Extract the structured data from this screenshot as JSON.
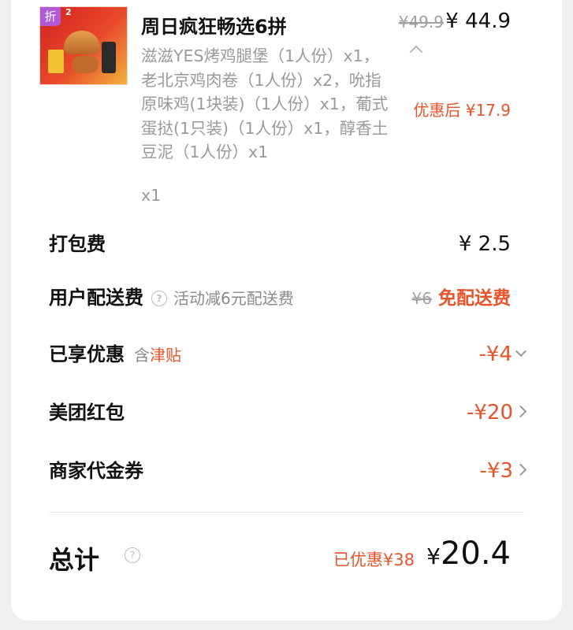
{
  "item": {
    "badge": "折",
    "badge_count": "2",
    "title": "周日疯狂畅选6拼",
    "description": "滋滋YES烤鸡腿堡（1人份）x1，老北京鸡肉卷（1人份）x2，吮指原味鸡(1块装)（1人份）x1，葡式蛋挞(1只装)（1人份）x1，醇香土豆泥（1人份）x1",
    "quantity": "x1",
    "original_price": "¥49.9",
    "price": "¥ 44.9",
    "discounted_price": "优惠后 ¥17.9"
  },
  "rows": {
    "packing": {
      "label": "打包费",
      "value": "¥ 2.5"
    },
    "delivery": {
      "label": "用户配送费",
      "note": "活动减6元配送费",
      "original": "¥6",
      "value": "免配送费"
    },
    "discount": {
      "label": "已享优惠",
      "note_prefix": "含",
      "note_highlight": "津贴",
      "value": "-¥4"
    },
    "redpacket": {
      "label": "美团红包",
      "value": "-¥20"
    },
    "voucher": {
      "label": "商家代金券",
      "value": "-¥3"
    }
  },
  "total": {
    "label": "总计",
    "saved": "已优惠¥38",
    "currency": "¥",
    "amount": "20.4"
  },
  "colors": {
    "accent": "#e8542a",
    "muted": "#9a9a9a"
  },
  "icons": [
    "help-icon",
    "chevron-up-icon",
    "chevron-down-icon",
    "chevron-right-icon"
  ]
}
